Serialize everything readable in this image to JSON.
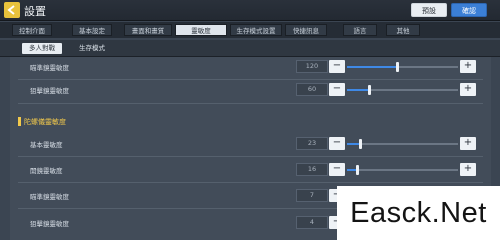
{
  "header": {
    "title": "設置",
    "back_icon": "arrow-left-icon",
    "default_label": "預設",
    "confirm_label": "確認"
  },
  "tabs": [
    {
      "label": "控制介面",
      "active": false
    },
    {
      "label": "基本設定",
      "active": false
    },
    {
      "label": "畫面和畫質",
      "active": false
    },
    {
      "label": "靈敏度",
      "active": true
    },
    {
      "label": "生存模式設置",
      "active": false
    },
    {
      "label": "快捷訊息",
      "active": false
    },
    {
      "label": "語言",
      "active": false
    },
    {
      "label": "其他",
      "active": false
    }
  ],
  "subtabs": [
    {
      "label": "多人對戰",
      "active": true
    },
    {
      "label": "生存模式",
      "active": false
    }
  ],
  "section1": {
    "rows": [
      {
        "label": "瞄準鏡靈敏度",
        "value": "120",
        "fraction": 0.45
      },
      {
        "label": "狙擊鏡靈敏度",
        "value": "60",
        "fraction": 0.2
      }
    ]
  },
  "section2": {
    "title": "陀螺儀靈敏度",
    "rows": [
      {
        "label": "基本靈敏度",
        "value": "23",
        "fraction": 0.12
      },
      {
        "label": "開鏡靈敏度",
        "value": "16",
        "fraction": 0.09
      },
      {
        "label": "瞄準鏡靈敏度",
        "value": "7",
        "fraction": 0.04
      },
      {
        "label": "狙擊鏡靈敏度",
        "value": "4",
        "fraction": 0.02
      }
    ]
  },
  "watermark": "Easck.Net",
  "colors": {
    "accent": "#3f89e6",
    "section_title": "#f2c94c",
    "back_button": "#e8c23c",
    "confirm_button": "#3b7fd6"
  }
}
